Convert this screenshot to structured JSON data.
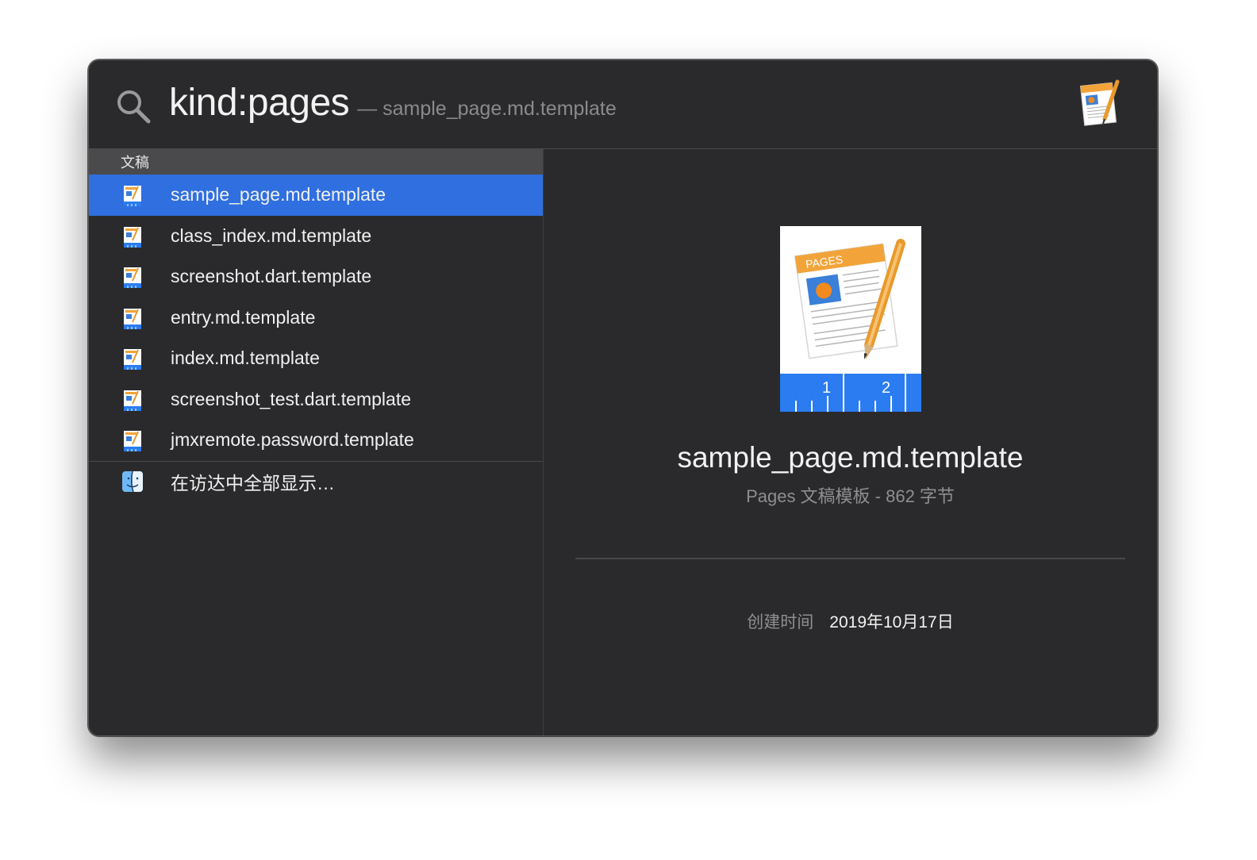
{
  "search": {
    "query": "kind:pages",
    "completion_hint": "— sample_page.md.template"
  },
  "results": {
    "section_label": "文稿",
    "items": [
      {
        "label": "sample_page.md.template",
        "selected": true
      },
      {
        "label": "class_index.md.template",
        "selected": false
      },
      {
        "label": "screenshot.dart.template",
        "selected": false
      },
      {
        "label": "entry.md.template",
        "selected": false
      },
      {
        "label": "index.md.template",
        "selected": false
      },
      {
        "label": "screenshot_test.dart.template",
        "selected": false
      },
      {
        "label": "jmxremote.password.template",
        "selected": false
      }
    ],
    "show_all_in_finder": "在访达中全部显示…"
  },
  "preview": {
    "icon_text": "PAGES",
    "ruler_numbers": [
      "1",
      "2"
    ],
    "title": "sample_page.md.template",
    "subtitle": "Pages 文稿模板 - 862 字节",
    "meta": {
      "created_label": "创建时间",
      "created_value": "2019年10月17日"
    }
  },
  "colors": {
    "window_bg": "#2a2a2c",
    "selection": "#2f6fdf",
    "section_header_bg": "#4a4a4c",
    "pages_orange": "#f2a43a",
    "pages_blue": "#2a7cf0"
  },
  "icons": {
    "search": "magnifying-glass-icon",
    "app": "pages-app-icon",
    "document": "pages-document-icon",
    "finder": "finder-icon"
  }
}
